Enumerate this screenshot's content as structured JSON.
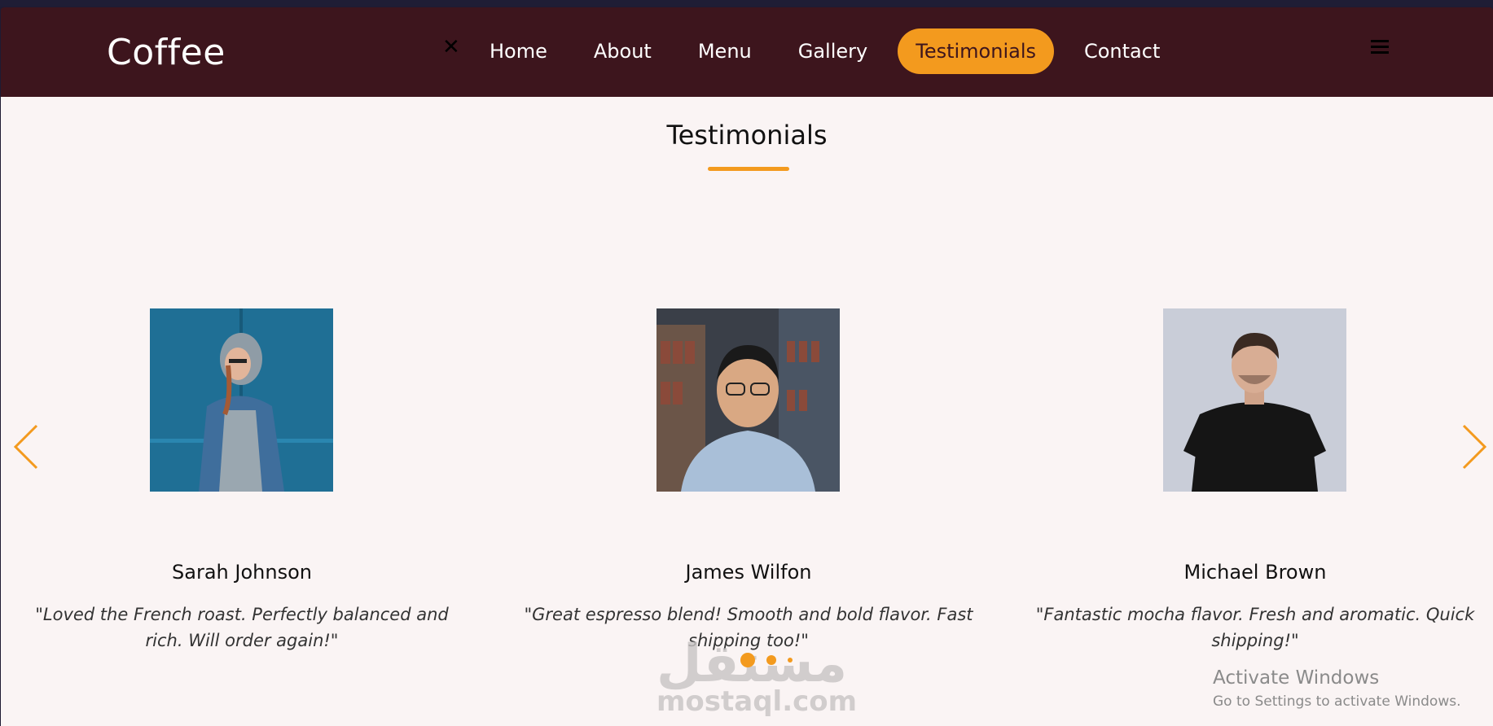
{
  "brand": "Coffee",
  "nav": {
    "close_symbol": "✕",
    "items": [
      {
        "label": "Home",
        "active": false
      },
      {
        "label": "About",
        "active": false
      },
      {
        "label": "Menu",
        "active": false
      },
      {
        "label": "Gallery",
        "active": false
      },
      {
        "label": "Testimonials",
        "active": true
      },
      {
        "label": "Contact",
        "active": false
      }
    ]
  },
  "section": {
    "title": "Testimonials"
  },
  "testimonials": [
    {
      "name": "Sarah Johnson",
      "quote": "\"Loved the French roast. Perfectly balanced and rich. Will order again!\""
    },
    {
      "name": "James Wilfon",
      "quote": "\"Great espresso blend! Smooth and bold flavor. Fast shipping too!\""
    },
    {
      "name": "Michael Brown",
      "quote": "\"Fantastic mocha flavor. Fresh and aromatic. Quick shipping!\""
    }
  ],
  "carousel": {
    "active_dot_index": 0,
    "dot_count": 3
  },
  "watermark": {
    "arabic": "مستقل",
    "latin": "mostaql.com"
  },
  "os_notice": {
    "title": "Activate Windows",
    "subtitle": "Go to Settings to activate Windows."
  },
  "colors": {
    "nav_bg": "#3d151d",
    "accent": "#f39a1e",
    "page_bg": "#faf4f4"
  },
  "icons": {
    "prev": "chevron-left-icon",
    "next": "chevron-right-icon",
    "menu": "hamburger-icon",
    "close": "close-icon"
  }
}
